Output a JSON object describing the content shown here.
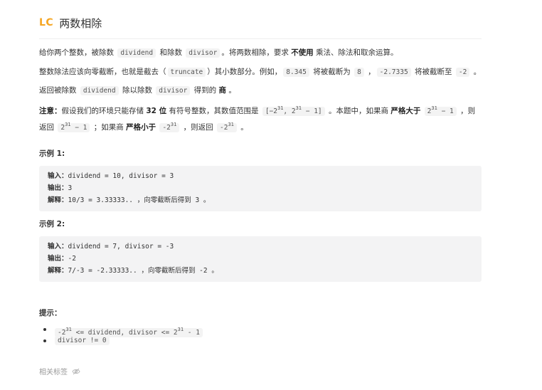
{
  "header": {
    "logo": "LC",
    "title": "两数相除"
  },
  "description": {
    "p1": {
      "a": "给你两个整数，被除数 ",
      "c1": "dividend",
      "b": " 和除数 ",
      "c2": "divisor",
      "c": "。将两数相除，要求 ",
      "strong": "不使用",
      "d": " 乘法、除法和取余运算。"
    },
    "p2": {
      "a": "整数除法应该向零截断，也就是截去（",
      "c1": "truncate",
      "b": "）其小数部分。例如，",
      "c2": "8.345",
      "c": " 将被截断为 ",
      "c3": "8",
      "d": " ，",
      "c4": "-2.7335",
      "e": " 将被截断至 ",
      "c5": "-2",
      "f": " 。"
    },
    "p3": {
      "a": "返回被除数 ",
      "c1": "dividend",
      "b": " 除以除数 ",
      "c2": "divisor",
      "c": " 得到的 ",
      "strong": "商",
      "d": " 。"
    },
    "p4": {
      "note": "注意：",
      "a": "假设我们的环境只能存储 ",
      "strong1": "32 位",
      "b": " 有符号整数，其数值范围是 ",
      "range_open": "[−2",
      "range_exp1": "31",
      "range_mid": ",  2",
      "range_exp2": "31",
      "range_close": " − 1]",
      "c": " 。本题中，如果商 ",
      "strong2": "严格大于",
      "d": " ",
      "max_base": "2",
      "max_exp": "31",
      "max_tail": " − 1",
      "e": " ，则返回 ",
      "ret_base": "2",
      "ret_exp": "31",
      "ret_tail": " − 1",
      "f": " ；如果商 ",
      "strong3": "严格小于",
      "g": " ",
      "min_base": "-2",
      "min_exp": "31",
      "h": " ，则返回 ",
      "ret2_base": "-2",
      "ret2_exp": "31",
      "i": " 。"
    }
  },
  "examples": [
    {
      "title": "示例 1:",
      "input_label": "输入：",
      "input": "dividend = 10, divisor = 3",
      "output_label": "输出：",
      "output": "3",
      "explain_label": "解释：",
      "explain": "10/3 = 3.33333.. ，向零截断后得到 3 。"
    },
    {
      "title": "示例 2:",
      "input_label": "输入：",
      "input": "dividend = 7, divisor = -3",
      "output_label": "输出：",
      "output": "-2",
      "explain_label": "解释：",
      "explain": "7/-3 = -2.33333.. ，向零截断后得到 -2 。"
    }
  ],
  "hints": {
    "title": "提示：",
    "h1": {
      "a": "-2",
      "exp1": "31",
      "b": " <= dividend, divisor <= 2",
      "exp2": "31",
      "c": " - 1"
    },
    "h2": "divisor != 0"
  },
  "tags": {
    "label": "相关标签",
    "icon": "eye-off-icon"
  }
}
